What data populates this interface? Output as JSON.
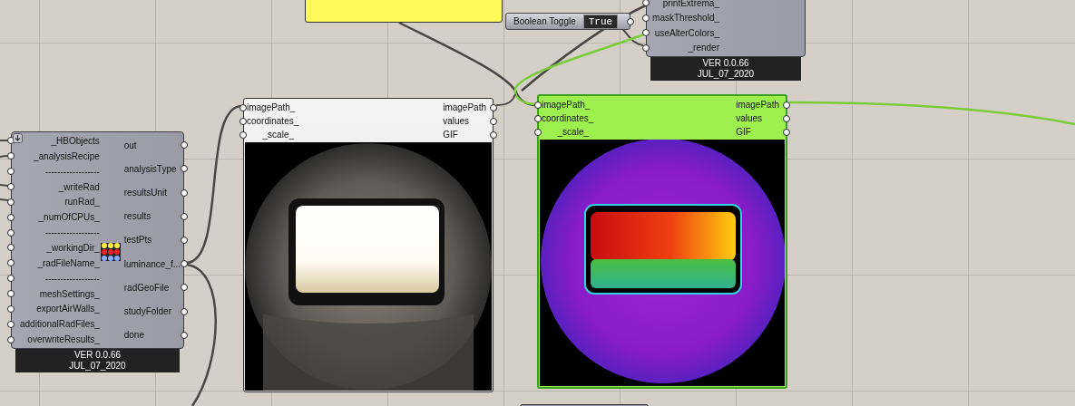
{
  "boolean_toggle": {
    "label": "Boolean Toggle",
    "value": "True"
  },
  "top_component": {
    "inputs": [
      "printExtrema_",
      "maskThreshold_",
      "useAlterColors_",
      "_render"
    ],
    "version": "VER 0.0.66",
    "date": "JUL_07_2020"
  },
  "analysis_component": {
    "inputs": [
      "_HBObjects",
      "_analysisRecipe",
      "------------------",
      "_writeRad",
      "runRad_",
      "_numOfCPUs_",
      "------------------",
      "_workingDir_",
      "_radFileName_",
      "------------------",
      "meshSettings_",
      "exportAirWalls_",
      "additionalRadFiles_",
      "overwriteResults_"
    ],
    "outputs": [
      "out",
      "analysisType",
      "resultsUnit",
      "results",
      "testPts",
      "luminance_f...",
      "radGeoFile",
      "studyFolder",
      "done"
    ],
    "version": "VER 0.0.66",
    "date": "JUL_07_2020"
  },
  "image_viewers": [
    {
      "kind": "render",
      "selected": false,
      "inputs": [
        "imagePath_",
        "coordinates_",
        "_scale_"
      ],
      "outputs": [
        "imagePath",
        "values",
        "GIF"
      ]
    },
    {
      "kind": "false_color",
      "selected": true,
      "inputs": [
        "imagePath_",
        "coordinates_",
        "_scale_"
      ],
      "outputs": [
        "imagePath",
        "values",
        "GIF"
      ]
    }
  ]
}
